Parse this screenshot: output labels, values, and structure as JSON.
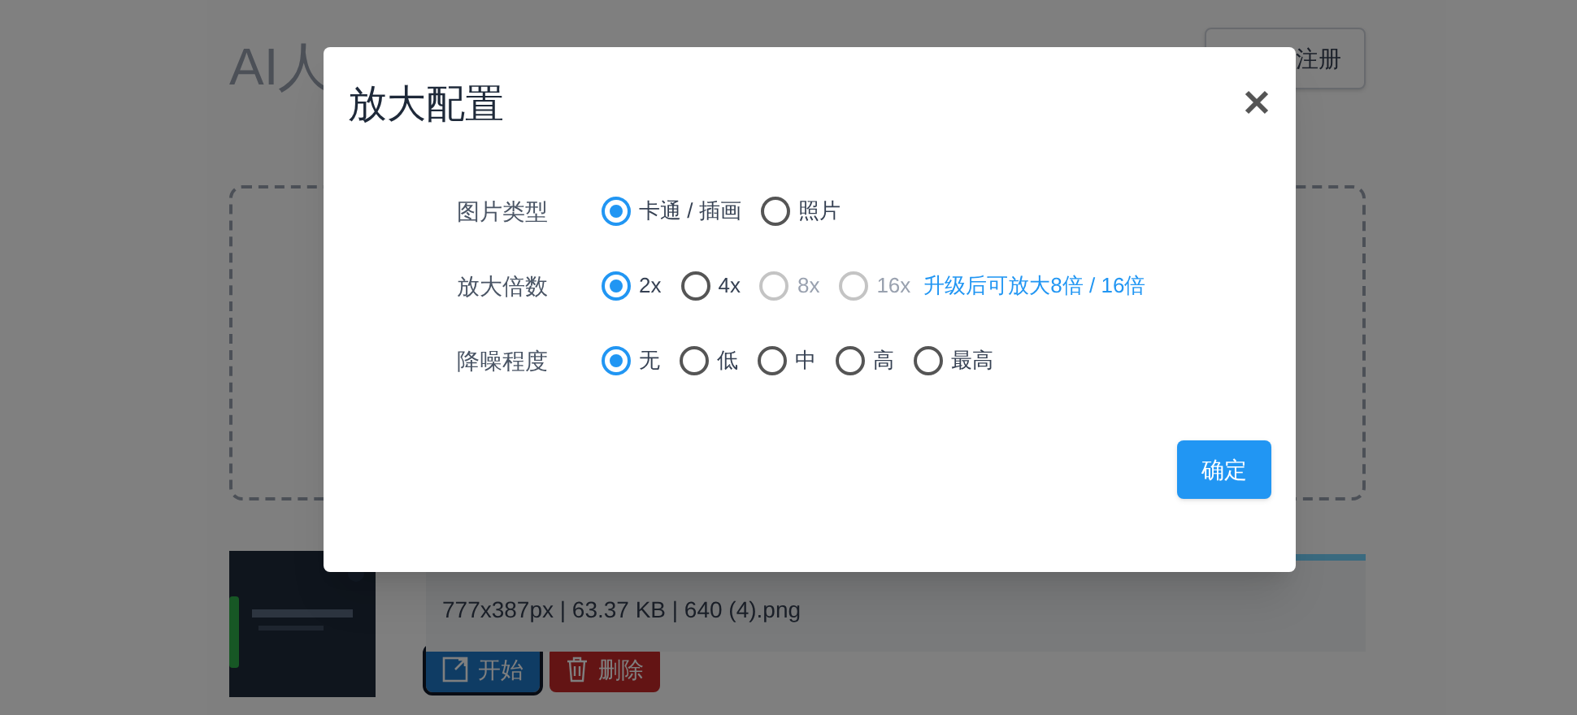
{
  "page": {
    "title": "AI人",
    "register_button": "注册",
    "file": {
      "progress": {
        "level": 1
      },
      "info": "777x387px | 63.37 KB | 640 (4).png",
      "buttons": [
        {
          "label": "开始",
          "kind": "start",
          "focused": true
        },
        {
          "label": "删除",
          "kind": "delete",
          "focused": false
        }
      ]
    }
  },
  "dialog": {
    "title": "放大配置",
    "groups": [
      {
        "label": "图片类型",
        "options": [
          {
            "label": "卡通 / 插画",
            "selected": true,
            "disabled": false
          },
          {
            "label": "照片",
            "selected": false,
            "disabled": false
          }
        ]
      },
      {
        "label": "放大倍数",
        "options": [
          {
            "label": "2x",
            "selected": true,
            "disabled": false
          },
          {
            "label": "4x",
            "selected": false,
            "disabled": false
          },
          {
            "label": "8x",
            "selected": false,
            "disabled": true
          },
          {
            "label": "16x",
            "selected": false,
            "disabled": true
          }
        ],
        "note": "升级后可放大8倍 / 16倍"
      },
      {
        "label": "降噪程度",
        "options": [
          {
            "label": "无",
            "selected": true,
            "disabled": false
          },
          {
            "label": "低",
            "selected": false,
            "disabled": false
          },
          {
            "label": "中",
            "selected": false,
            "disabled": false
          },
          {
            "label": "高",
            "selected": false,
            "disabled": false
          },
          {
            "label": "最高",
            "selected": false,
            "disabled": false
          }
        ]
      }
    ],
    "confirm": "确定"
  }
}
